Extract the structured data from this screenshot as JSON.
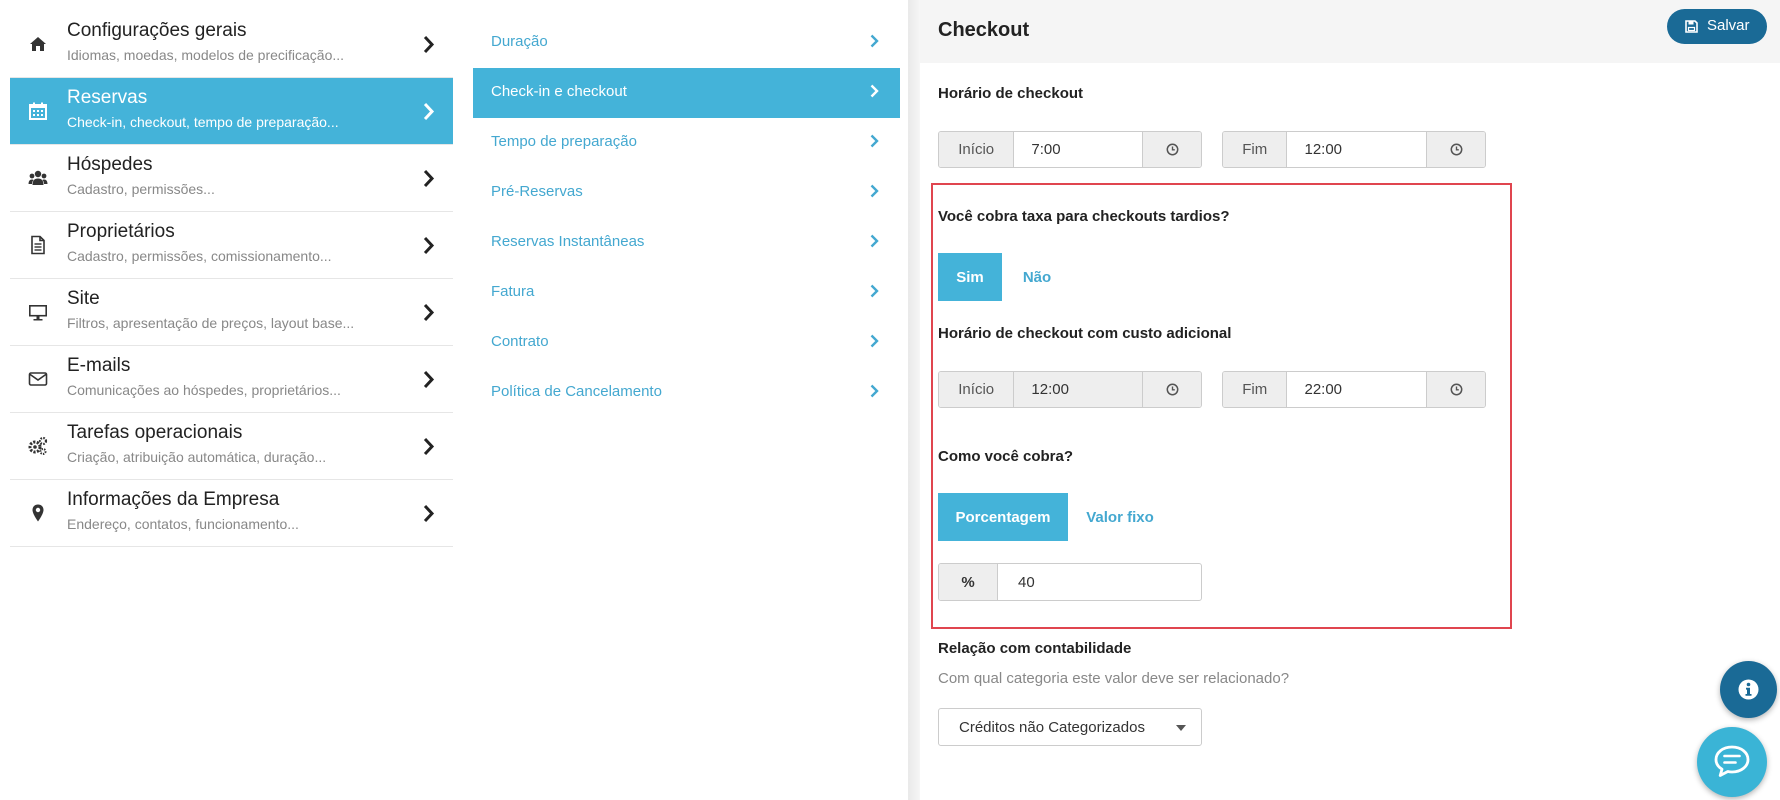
{
  "nav": {
    "items": [
      {
        "icon": "home-icon",
        "title": "Configurações gerais",
        "subtitle": "Idiomas, moedas, modelos de precificação..."
      },
      {
        "icon": "calendar-icon",
        "title": "Reservas",
        "subtitle": "Check-in, checkout, tempo de preparação..."
      },
      {
        "icon": "users-icon",
        "title": "Hóspedes",
        "subtitle": "Cadastro, permissões..."
      },
      {
        "icon": "document-icon",
        "title": "Proprietários",
        "subtitle": "Cadastro, permissões, comissionamento..."
      },
      {
        "icon": "monitor-icon",
        "title": "Site",
        "subtitle": "Filtros, apresentação de preços, layout base..."
      },
      {
        "icon": "envelope-icon",
        "title": "E-mails",
        "subtitle": "Comunicações ao hóspedes, proprietários..."
      },
      {
        "icon": "gears-icon",
        "title": "Tarefas operacionais",
        "subtitle": "Criação, atribuição automática, duração..."
      },
      {
        "icon": "map-pin-icon",
        "title": "Informações da Empresa",
        "subtitle": "Endereço, contatos, funcionamento..."
      }
    ],
    "active_index": 1
  },
  "subnav": {
    "items": [
      "Duração",
      "Check-in e checkout",
      "Tempo de preparação",
      "Pré-Reservas",
      "Reservas Instantâneas",
      "Fatura",
      "Contrato",
      "Política de Cancelamento"
    ],
    "active_index": 1
  },
  "panel": {
    "title": "Checkout",
    "save_label": "Salvar",
    "checkout_time": {
      "label": "Horário de checkout",
      "start_label": "Início",
      "start_value": "7:00",
      "end_label": "Fim",
      "end_value": "12:00"
    },
    "late_fee": {
      "question": "Você cobra taxa para checkouts tardios?",
      "yes_label": "Sim",
      "no_label": "Não",
      "selected": "Sim"
    },
    "late_time": {
      "label": "Horário de checkout com custo adicional",
      "start_label": "Início",
      "start_value": "12:00",
      "end_label": "Fim",
      "end_value": "22:00"
    },
    "charge_type": {
      "question": "Como você cobra?",
      "percent_label": "Porcentagem",
      "fixed_label": "Valor fixo",
      "selected": "Porcentagem"
    },
    "percent": {
      "symbol": "%",
      "value": "40"
    },
    "accounting": {
      "label": "Relação com contabilidade",
      "hint": "Com qual categoria este valor deve ser relacionado?",
      "selected": "Créditos não Categorizados"
    }
  },
  "colors": {
    "accent": "#44b3d9",
    "link": "#44a8d0",
    "save_button": "#1a6a96",
    "highlight_border": "#e0454f"
  }
}
